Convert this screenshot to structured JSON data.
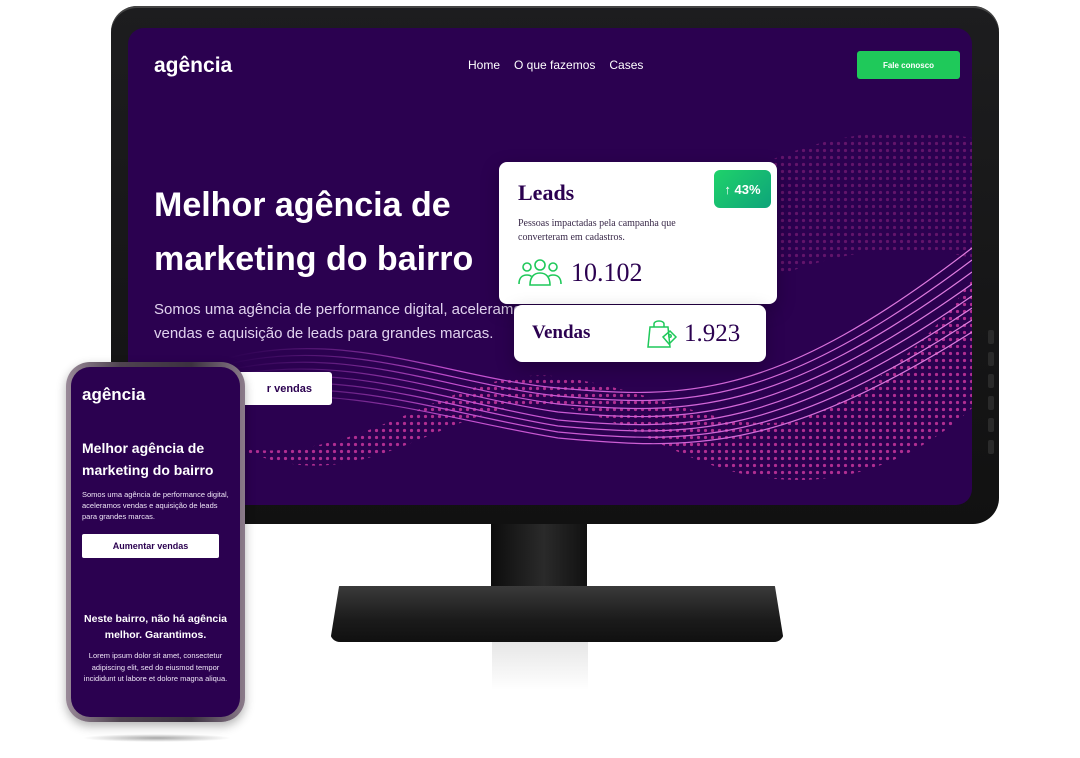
{
  "desktop": {
    "logo": "agência",
    "nav": [
      "Home",
      "O que fazemos",
      "Cases"
    ],
    "cta": "Fale conosco",
    "hero_title": "Melhor agência de marketing do bairro",
    "hero_subtitle": "Somos uma agência de performance digital, aceleramos vendas e aquisição de leads para grandes marcas.",
    "hero_button": "r vendas",
    "leads_card": {
      "title": "Leads",
      "badge": "↑ 43%",
      "description": "Pessoas impactadas pela campanha que converteram em cadastros.",
      "value": "10.102",
      "icon": "users-icon"
    },
    "vendas_card": {
      "title": "Vendas",
      "value": "1.923",
      "icon": "shopping-bag-icon"
    }
  },
  "mobile": {
    "logo": "agência",
    "hero_title": "Melhor agência de marketing do bairro",
    "hero_subtitle": "Somos uma agência de performance digital, aceleramos vendas e aquisição de leads para grandes marcas.",
    "hero_button": "Aumentar vendas",
    "section_title": "Neste bairro, não há agência melhor. Garantimos.",
    "section_body": "Lorem ipsum dolor sit amet, consectetur adipiscing elit, sed do eiusmod tempor incididunt ut labore et dolore magna aliqua."
  },
  "colors": {
    "background": "#2b0150",
    "accent": "#1fc95a",
    "wave": "#d24fd0"
  }
}
